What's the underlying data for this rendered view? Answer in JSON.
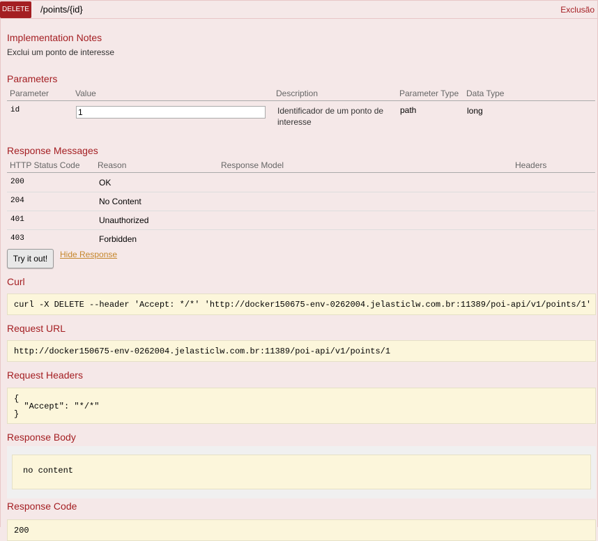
{
  "operation": {
    "method": "DELETE",
    "path": "/points/{id}",
    "summary": "Exclusão"
  },
  "implementation_notes": {
    "heading": "Implementation Notes",
    "text": "Exclui um ponto de interesse"
  },
  "parameters": {
    "heading": "Parameters",
    "columns": [
      "Parameter",
      "Value",
      "Description",
      "Parameter Type",
      "Data Type"
    ],
    "rows": [
      {
        "name": "id",
        "value": "1",
        "description_line1": "Identificador de um ponto de",
        "description_line2": "interesse",
        "param_type": "path",
        "data_type": "long"
      }
    ]
  },
  "response_messages": {
    "heading": "Response Messages",
    "columns": [
      "HTTP Status Code",
      "Reason",
      "Response Model",
      "Headers"
    ],
    "rows": [
      {
        "code": "200",
        "reason": "OK"
      },
      {
        "code": "204",
        "reason": "No Content"
      },
      {
        "code": "401",
        "reason": "Unauthorized"
      },
      {
        "code": "403",
        "reason": "Forbidden"
      }
    ]
  },
  "actions": {
    "try_label": "Try it out!",
    "hide_label": "Hide Response"
  },
  "curl": {
    "heading": "Curl",
    "command": "curl -X DELETE --header 'Accept: */*' 'http://docker150675-env-0262004.jelasticlw.com.br:11389/poi-api/v1/points/1'"
  },
  "request_url": {
    "heading": "Request URL",
    "url": "http://docker150675-env-0262004.jelasticlw.com.br:11389/poi-api/v1/points/1"
  },
  "request_headers": {
    "heading": "Request Headers",
    "line1": "{",
    "line2": "  \"Accept\": \"*/*\"",
    "line3": "}"
  },
  "response_body": {
    "heading": "Response Body",
    "text": "no content"
  },
  "response_code": {
    "heading": "Response Code",
    "code": "200"
  },
  "colors": {
    "accent": "#a41e22",
    "background": "#f5e8e8",
    "code_background": "#fcf6db"
  }
}
